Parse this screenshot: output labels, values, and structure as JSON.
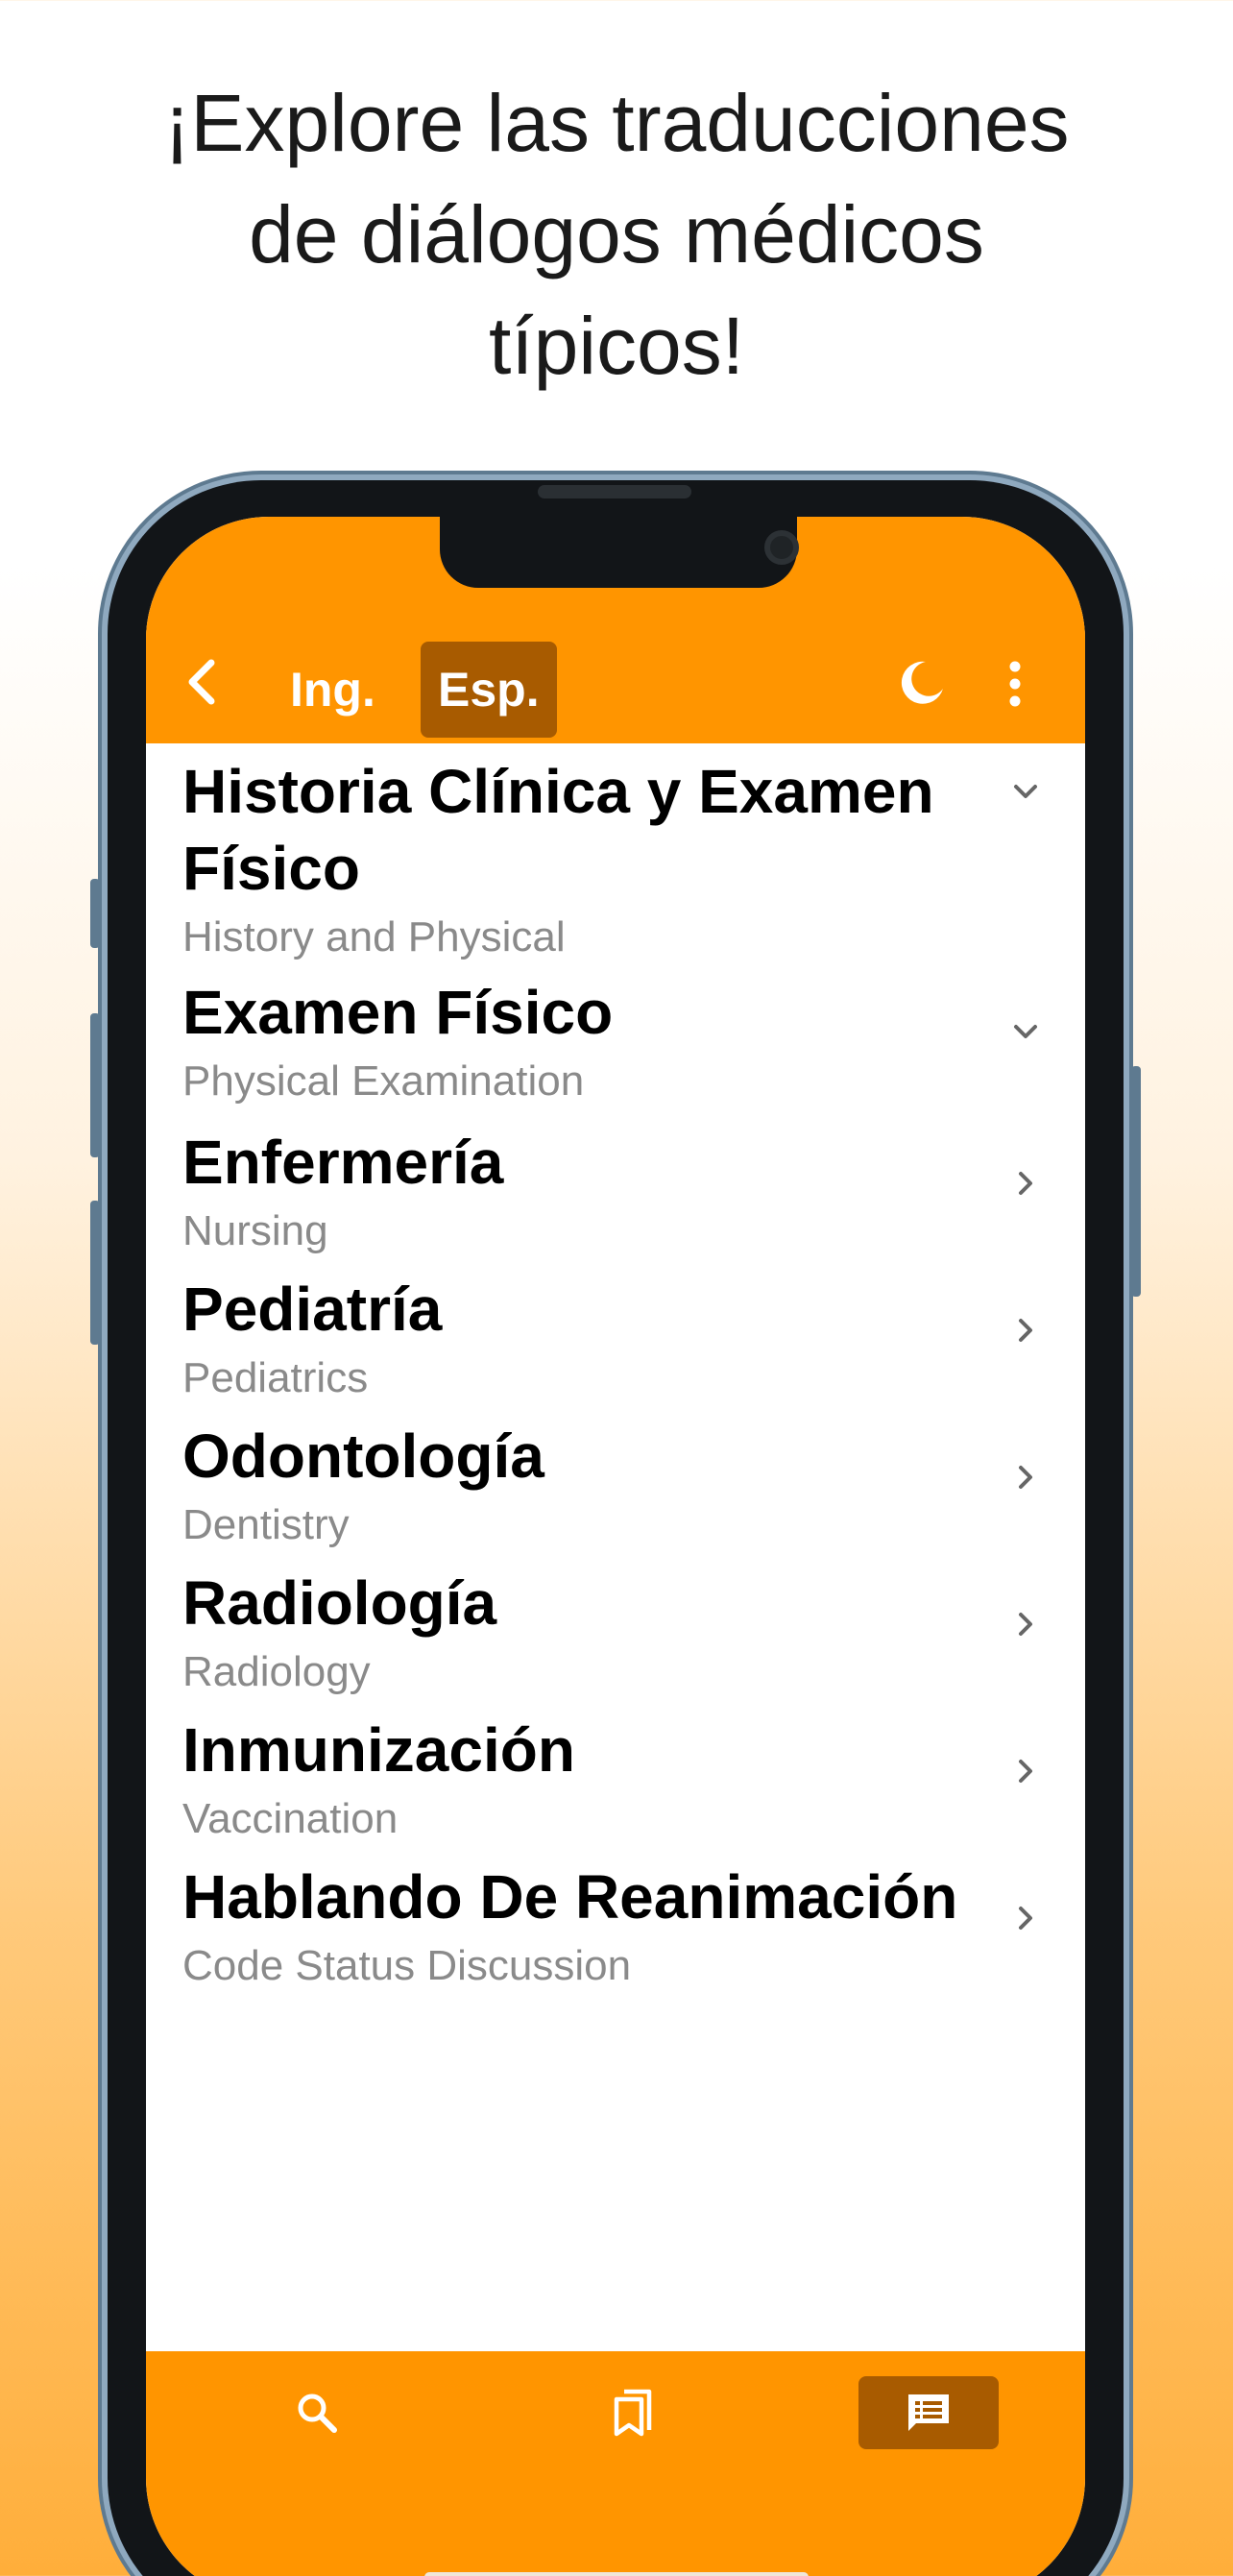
{
  "headline": {
    "line1": "¡Explore las traducciones",
    "line2": "de diálogos médicos",
    "line3": "típicos!"
  },
  "nav": {
    "back_icon": "chevron-left-icon",
    "lang_english": "Ing.",
    "lang_spanish": "Esp.",
    "selected_lang": "Esp.",
    "dark_mode_icon": "moon-icon",
    "more_icon": "more-vertical-icon"
  },
  "items": [
    {
      "title": "Historia Clínica y Examen Físico",
      "subtitle": "History and Physical",
      "icon": "chevron-down-icon"
    },
    {
      "title": "Examen Físico",
      "subtitle": "Physical Examination",
      "icon": "chevron-down-icon"
    },
    {
      "title": "Enfermería",
      "subtitle": "Nursing",
      "icon": "chevron-right-icon"
    },
    {
      "title": "Pediatría",
      "subtitle": "Pediatrics",
      "icon": "chevron-right-icon"
    },
    {
      "title": "Odontología",
      "subtitle": "Dentistry",
      "icon": "chevron-right-icon"
    },
    {
      "title": "Radiología",
      "subtitle": "Radiology",
      "icon": "chevron-right-icon"
    },
    {
      "title": "Inmunización",
      "subtitle": "Vaccination",
      "icon": "chevron-right-icon"
    },
    {
      "title": "Hablando De Reanimación",
      "subtitle": "Code Status Discussion",
      "icon": "chevron-right-icon"
    }
  ],
  "tabs": [
    {
      "icon": "search-icon",
      "selected": false
    },
    {
      "icon": "bookmarks-icon",
      "selected": false
    },
    {
      "icon": "dialogs-icon",
      "selected": true
    }
  ],
  "colors": {
    "accent": "#ff9500",
    "accent_dark": "#a85b00",
    "subtitle": "#8a8a8a"
  }
}
